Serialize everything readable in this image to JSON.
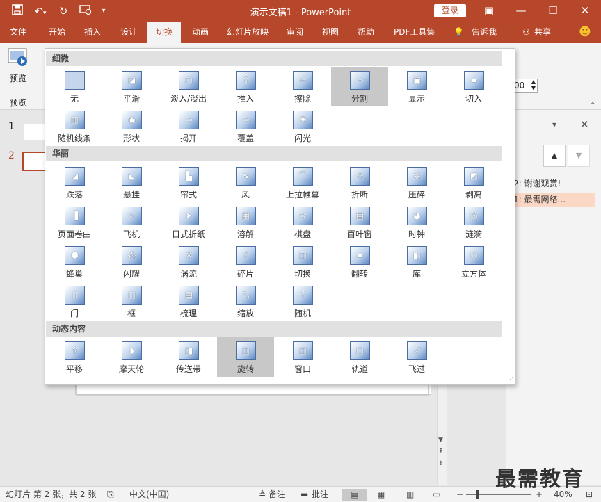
{
  "window": {
    "title": "演示文稿1  -  PowerPoint",
    "login_label": "登录",
    "minimize_icon": "—",
    "maximize_icon": "☐",
    "close_icon": "✕",
    "restore_ribbon_icon": "▣"
  },
  "quick_access": {
    "save_icon": "save-icon",
    "undo_icon": "undo-icon",
    "redo_icon": "redo-icon",
    "slideshow_icon": "present-from-start-icon",
    "customize_icon": "customize-icon"
  },
  "ribbon_tabs": [
    {
      "label": "文件"
    },
    {
      "label": "开始"
    },
    {
      "label": "插入"
    },
    {
      "label": "设计"
    },
    {
      "label": "切换",
      "active": true
    },
    {
      "label": "动画"
    },
    {
      "label": "幻灯片放映"
    },
    {
      "label": "审阅"
    },
    {
      "label": "视图"
    },
    {
      "label": "帮助"
    },
    {
      "label": "PDF工具集"
    },
    {
      "label": "告诉我"
    },
    {
      "label": "共享"
    }
  ],
  "ribbon": {
    "preview_label": "预览",
    "preview_group_label": "预览",
    "duration_value": "00"
  },
  "slides_panel": {
    "slide1_number": "1",
    "slide2_number": "2"
  },
  "gallery": {
    "sections": [
      {
        "title": "细微",
        "items": [
          {
            "label": "无",
            "icon": ""
          },
          {
            "label": "平滑",
            "icon": "◪"
          },
          {
            "label": "淡入/淡出",
            "icon": "▢"
          },
          {
            "label": "推入",
            "icon": "⇧"
          },
          {
            "label": "擦除",
            "icon": "⇦"
          },
          {
            "label": "分割",
            "icon": "⇔",
            "selected": true
          },
          {
            "label": "显示",
            "icon": "▣"
          },
          {
            "label": "切入",
            "icon": "▰"
          },
          {
            "label": "随机线条",
            "icon": "▥"
          },
          {
            "label": "形状",
            "icon": "◉"
          },
          {
            "label": "揭开",
            "icon": "⇦"
          },
          {
            "label": "覆盖",
            "icon": "⇦"
          },
          {
            "label": "闪光",
            "icon": "✺"
          }
        ]
      },
      {
        "title": "华丽",
        "items": [
          {
            "label": "跌落",
            "icon": "◢"
          },
          {
            "label": "悬挂",
            "icon": "◣"
          },
          {
            "label": "帘式",
            "icon": "▙"
          },
          {
            "label": "风",
            "icon": "≋"
          },
          {
            "label": "上拉帷幕",
            "icon": "⌒"
          },
          {
            "label": "折断",
            "icon": "✳"
          },
          {
            "label": "压碎",
            "icon": "✽"
          },
          {
            "label": "剥离",
            "icon": "◩"
          },
          {
            "label": "页面卷曲",
            "icon": "▐"
          },
          {
            "label": "飞机",
            "icon": "➢"
          },
          {
            "label": "日式折纸",
            "icon": "➤"
          },
          {
            "label": "溶解",
            "icon": "▦"
          },
          {
            "label": "棋盘",
            "icon": "⇨"
          },
          {
            "label": "百叶窗",
            "icon": "▤"
          },
          {
            "label": "时钟",
            "icon": "◕"
          },
          {
            "label": "涟漪",
            "icon": "◎"
          },
          {
            "label": "蜂巢",
            "icon": "⬢"
          },
          {
            "label": "闪耀",
            "icon": "⁂"
          },
          {
            "label": "涡流",
            "icon": "※"
          },
          {
            "label": "碎片",
            "icon": "⫽"
          },
          {
            "label": "切换",
            "icon": "◫"
          },
          {
            "label": "翻转",
            "icon": "▰"
          },
          {
            "label": "库",
            "icon": "◧"
          },
          {
            "label": "立方体",
            "icon": "⬡"
          },
          {
            "label": "门",
            "icon": "▯"
          },
          {
            "label": "框",
            "icon": "◫"
          },
          {
            "label": "梳理",
            "icon": "▤"
          },
          {
            "label": "缩放",
            "icon": "⤡"
          },
          {
            "label": "随机",
            "icon": "?"
          }
        ]
      },
      {
        "title": "动态内容",
        "items": [
          {
            "label": "平移",
            "icon": "⇧"
          },
          {
            "label": "摩天轮",
            "icon": "◗"
          },
          {
            "label": "传送带",
            "icon": "◨"
          },
          {
            "label": "旋转",
            "icon": "◫",
            "selected": true
          },
          {
            "label": "窗口",
            "icon": "◫"
          },
          {
            "label": "轨道",
            "icon": "▢"
          },
          {
            "label": "飞过",
            "icon": "⤢"
          }
        ]
      }
    ]
  },
  "anim_panel": {
    "item1": "2: 谢谢观赏!",
    "item2": "1: 最需网络..."
  },
  "status": {
    "slide_info": "幻灯片 第 2 张，共 2 张",
    "language": "中文(中国)",
    "notes": "备注",
    "comments": "批注",
    "zoom": "40%",
    "zoom_level_fraction": 0.4
  },
  "watermark": "最需教育",
  "colors": {
    "accent": "#b7472a",
    "tile_selected": "#c8c8c8"
  }
}
